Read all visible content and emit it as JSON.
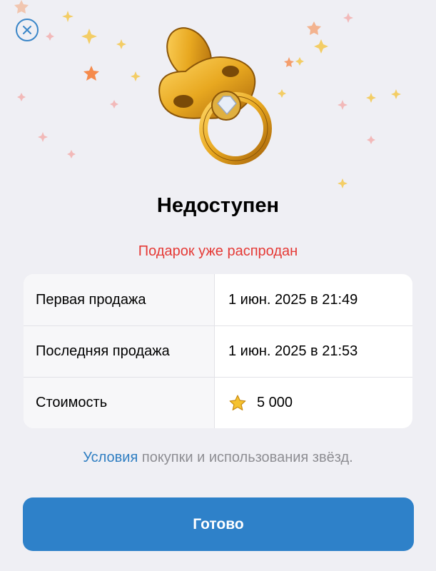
{
  "header": {
    "close_icon": "close-icon"
  },
  "gift": {
    "icon": "golden-pacifier-icon",
    "title": "Недоступен",
    "status": "Подарок уже распродан"
  },
  "details": {
    "rows": [
      {
        "label": "Первая продажа",
        "value": "1 июн. 2025 в 21:49"
      },
      {
        "label": "Последняя продажа",
        "value": "1 июн. 2025 в 21:53"
      },
      {
        "label": "Стоимость",
        "value": "5 000",
        "icon": "star-icon"
      }
    ]
  },
  "terms": {
    "link": "Условия",
    "rest": " покупки и использования звёзд."
  },
  "button": {
    "label": "Готово"
  },
  "colors": {
    "accent": "#2e81c9",
    "status_red": "#e53935",
    "gold": "#e8a820"
  }
}
